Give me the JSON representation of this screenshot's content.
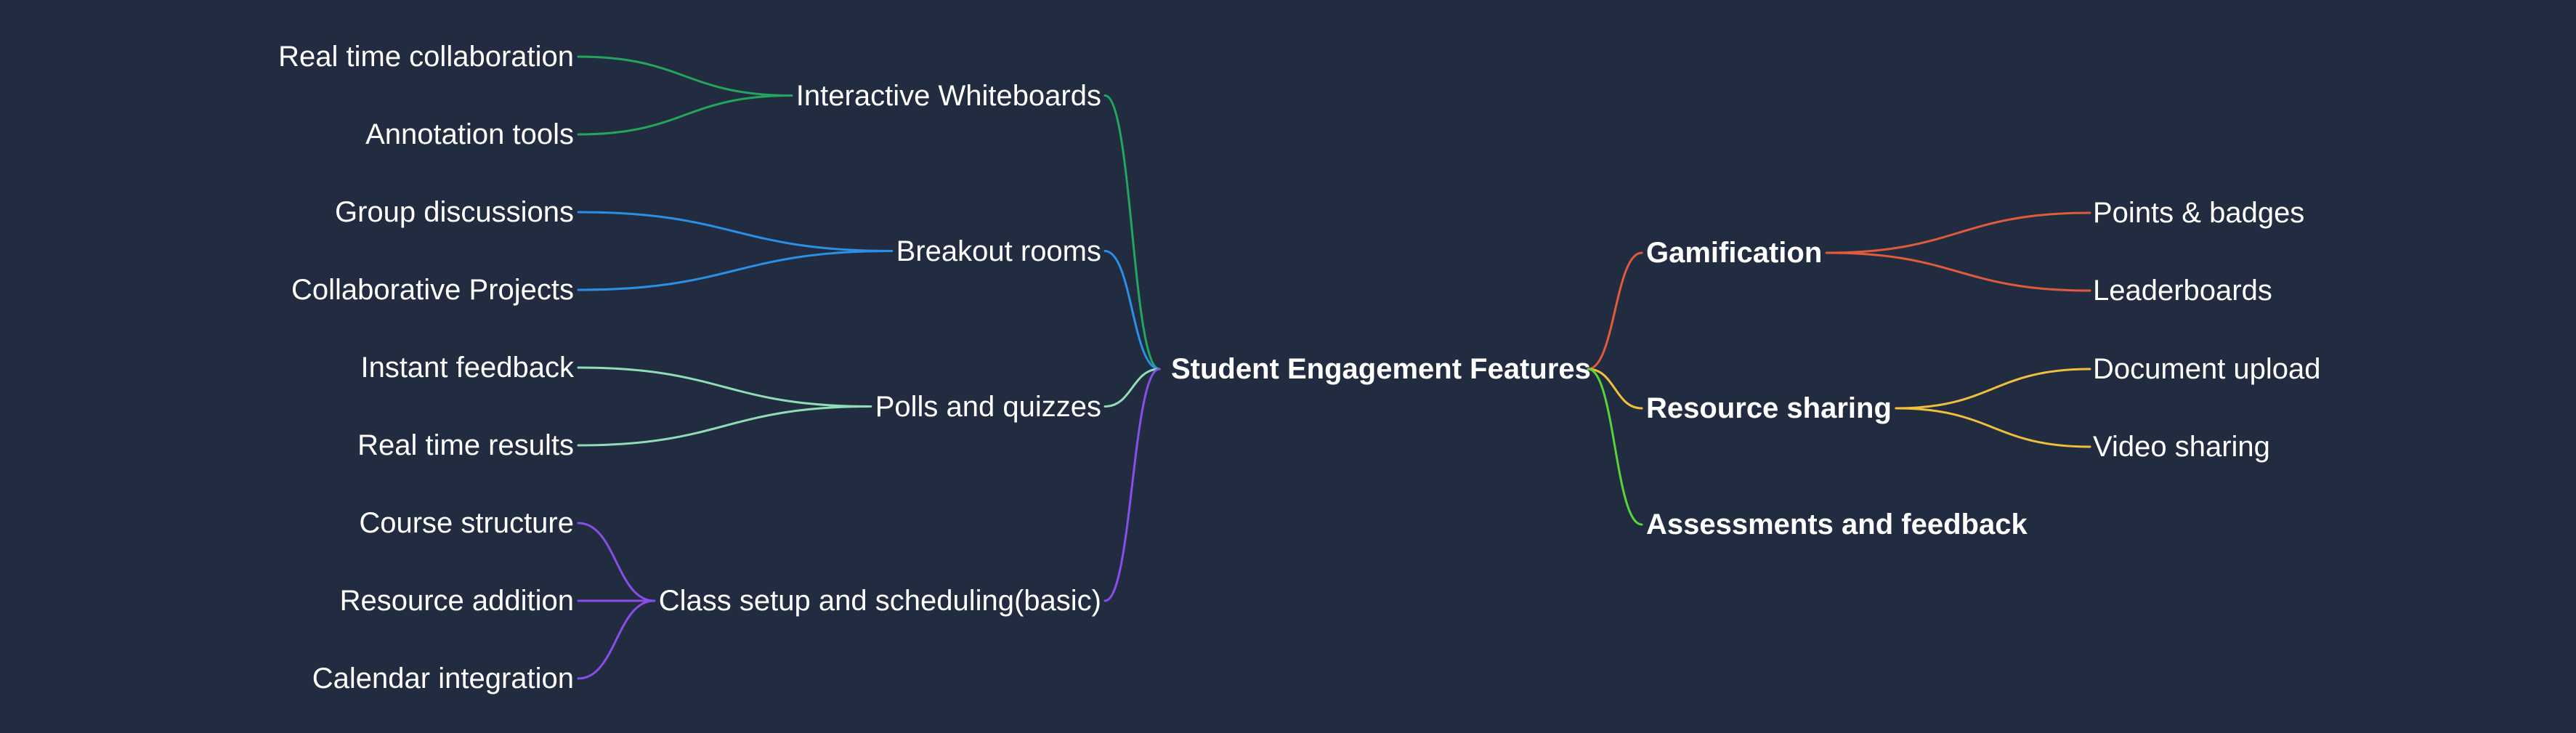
{
  "root": {
    "label": "Student Engagement Features"
  },
  "left_branches": [
    {
      "label": "Interactive Whiteboards",
      "color": "#22a55e",
      "children": [
        "Real time collaboration",
        "Annotation tools"
      ]
    },
    {
      "label": "Breakout rooms",
      "color": "#2b8fe6",
      "children": [
        "Group discussions",
        "Collaborative Projects"
      ]
    },
    {
      "label": "Polls and quizzes",
      "color": "#8fdcb6",
      "children": [
        "Instant feedback",
        "Real time results"
      ]
    },
    {
      "label": "Class setup and scheduling(basic)",
      "color": "#8a4ee8",
      "children": [
        "Course structure",
        "Resource addition",
        "Calendar integration"
      ]
    }
  ],
  "right_branches": [
    {
      "label": "Gamification",
      "color": "#e05a3c",
      "children": [
        "Points & badges",
        "Leaderboards"
      ]
    },
    {
      "label": "Resource sharing",
      "color": "#f0bf3c",
      "children": [
        "Document upload",
        "Video sharing"
      ]
    },
    {
      "label": "Assessments and feedback",
      "color": "#56d43a",
      "children": []
    }
  ]
}
